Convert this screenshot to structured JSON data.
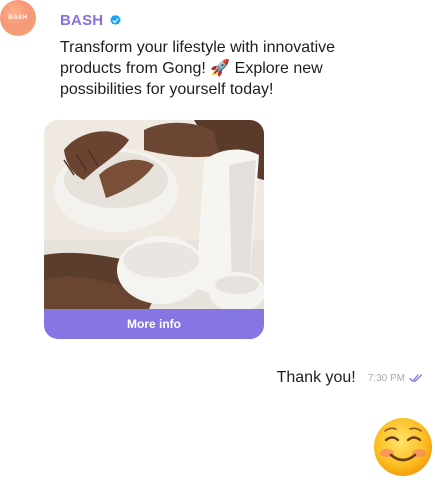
{
  "sender": {
    "avatar_text": "BASH",
    "name": "BASH",
    "verified_icon": "verified-badge-icon",
    "verified_color": "#1da1f2"
  },
  "message": {
    "text": "Transform your lifestyle with innovative products from Gong! 🚀 Explore new possibilities for yourself today!"
  },
  "card": {
    "image_alt": "product-photo-ceramic-bowls",
    "button_label": "More info",
    "button_color": "#8576e3"
  },
  "reply": {
    "text": "Thank you!",
    "time": "7:30 PM",
    "status_icon": "double-check-icon",
    "status_color": "#8576e3"
  },
  "emoji": {
    "icon": "smiling-face-emoji"
  },
  "colors": {
    "accent": "#8b6fe6",
    "background": "#ffffff"
  }
}
